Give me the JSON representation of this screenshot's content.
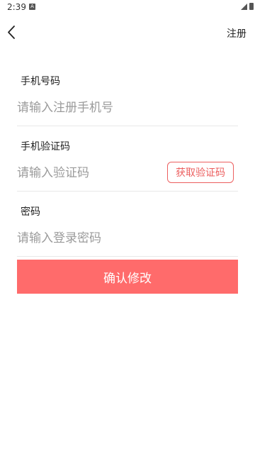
{
  "status_bar": {
    "time": "2:39",
    "notification_glyph": "A"
  },
  "header": {
    "back_icon": "chevron-left-icon",
    "register_label": "注册"
  },
  "form": {
    "phone": {
      "label": "手机号码",
      "placeholder": "请输入注册手机号",
      "value": ""
    },
    "code": {
      "label": "手机验证码",
      "placeholder": "请输入验证码",
      "value": "",
      "get_code_label": "获取验证码"
    },
    "password": {
      "label": "密码",
      "placeholder": "请输入登录密码",
      "value": ""
    }
  },
  "confirm_label": "确认修改",
  "colors": {
    "accent": "#ff6b6b",
    "accent_border": "#ec5f5f"
  }
}
